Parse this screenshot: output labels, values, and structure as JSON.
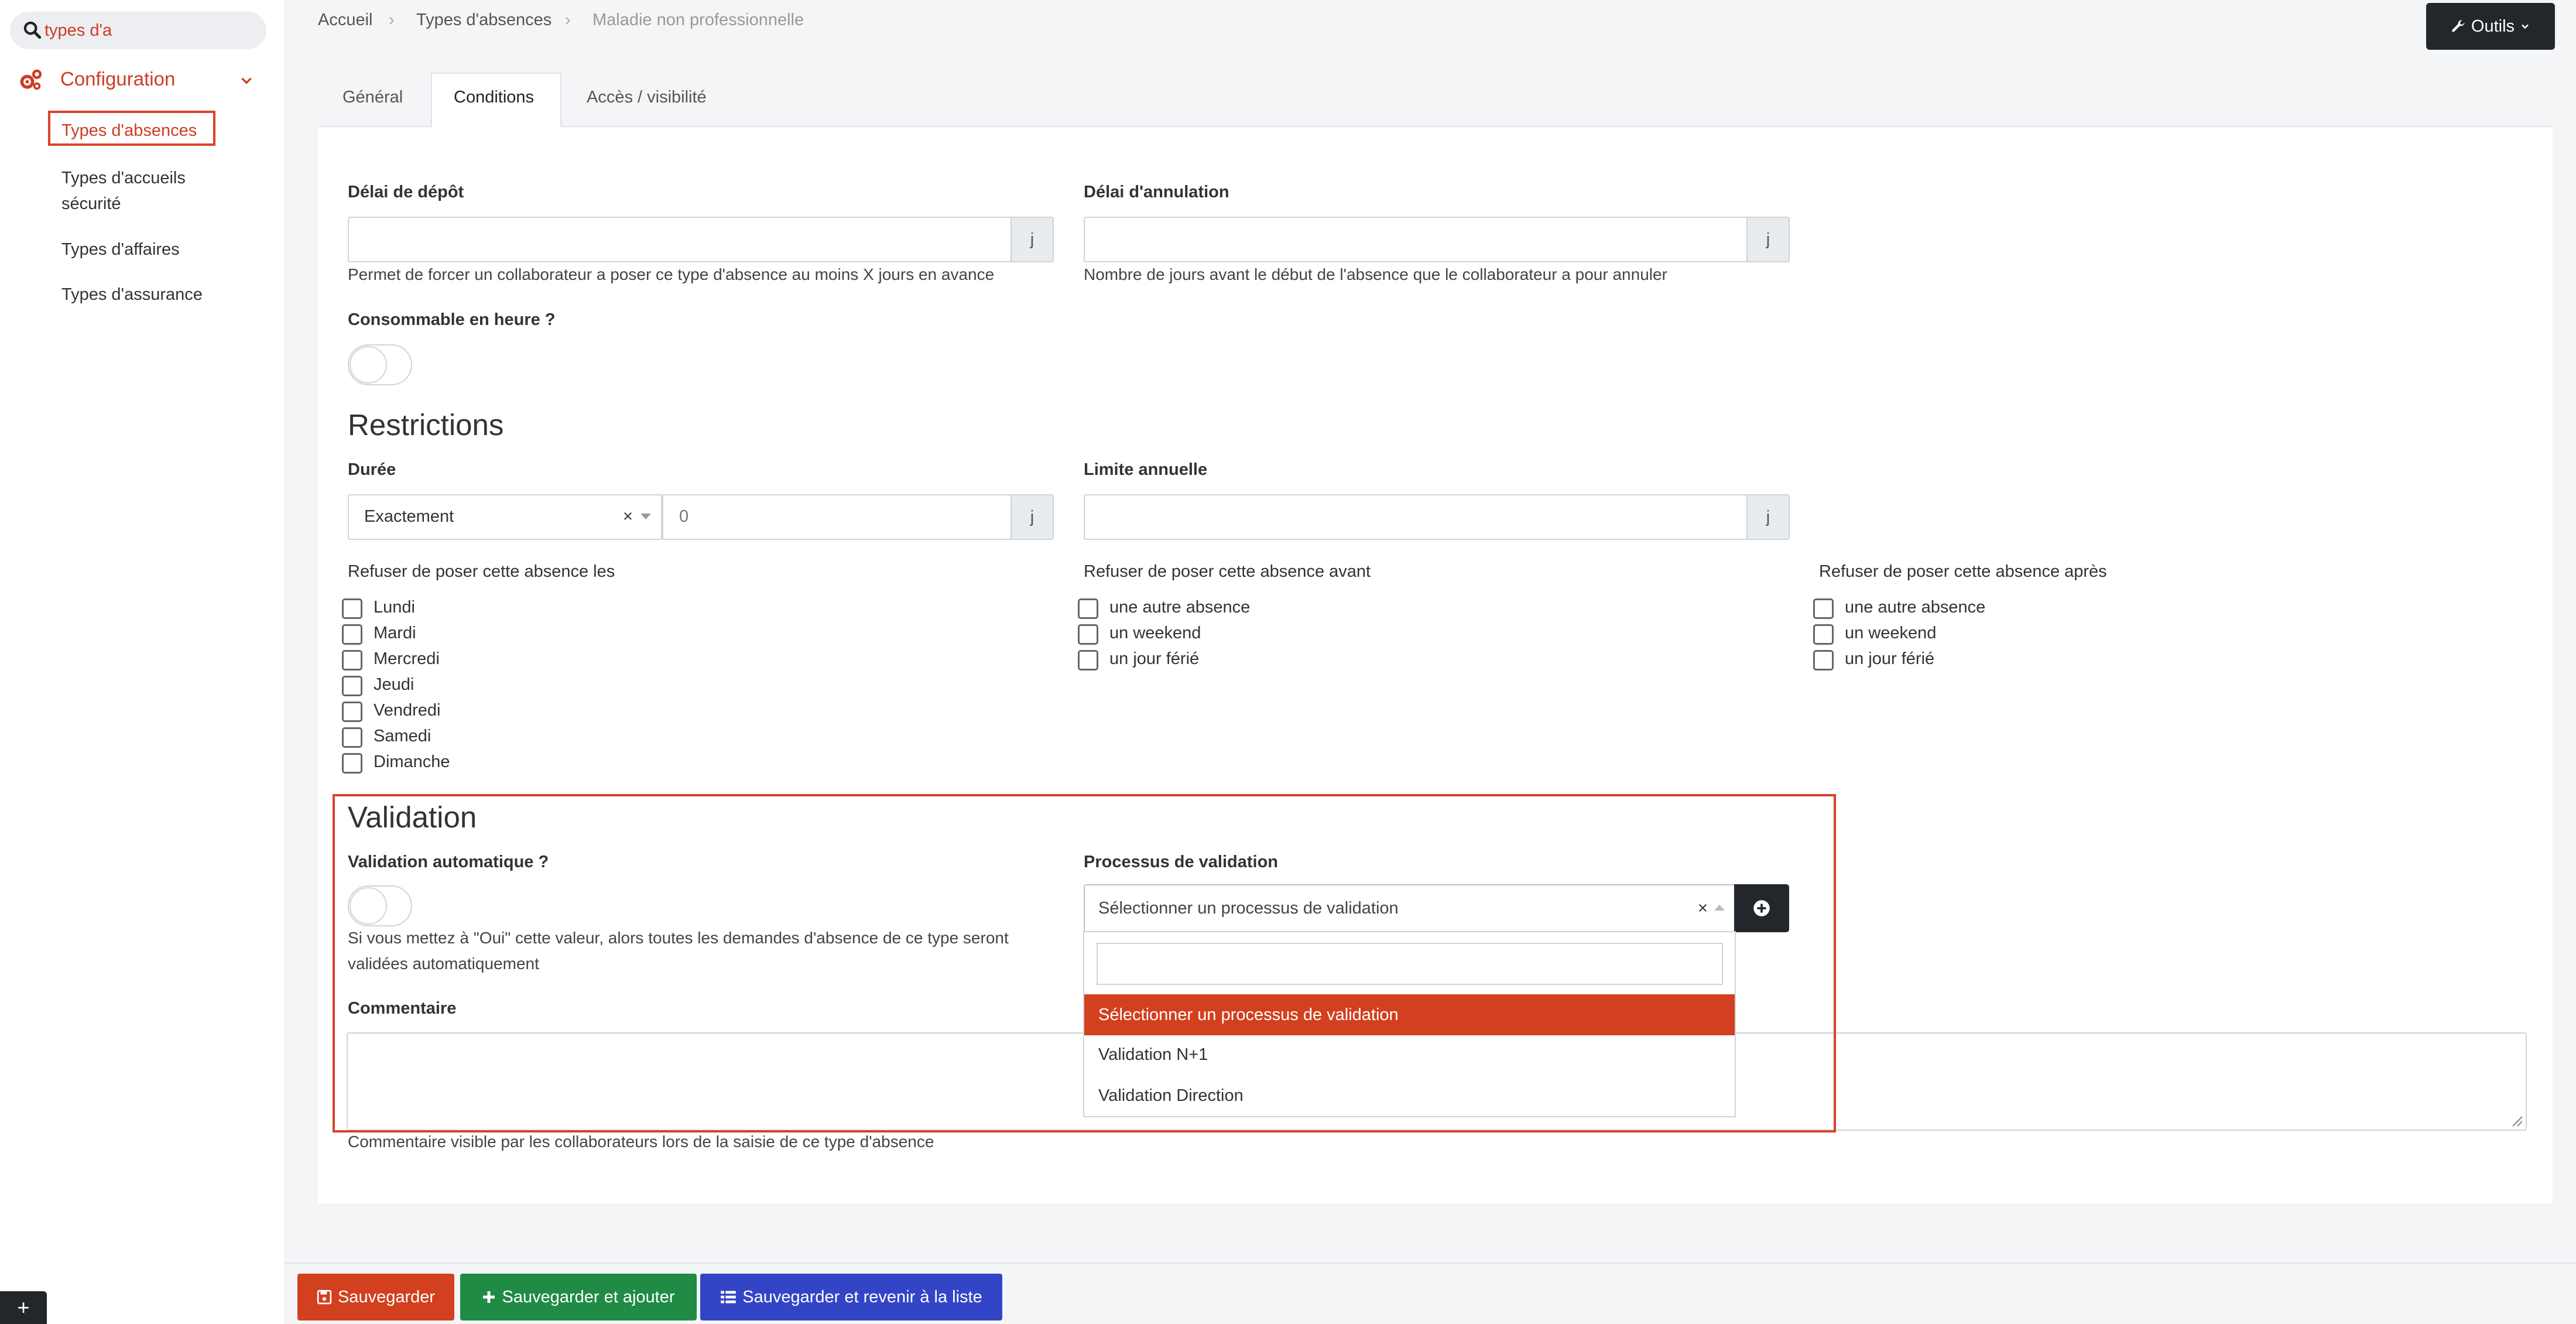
{
  "sidebar": {
    "search_value": "types d'a",
    "section_label": "Configuration",
    "items": [
      {
        "label": "Types d'absences",
        "active": true
      },
      {
        "label": "Types d'accueils sécurité",
        "line1": "Types d'accueils",
        "line2": "sécurité"
      },
      {
        "label": "Types d'affaires"
      },
      {
        "label": "Types d'assurance"
      }
    ]
  },
  "breadcrumb": [
    "Accueil",
    "Types d'absences",
    "Maladie non professionnelle"
  ],
  "tools_label": "Outils",
  "tabs": [
    "Général",
    "Conditions",
    "Accès / visibilité"
  ],
  "form": {
    "delai_depot": {
      "label": "Délai de dépôt",
      "value": "",
      "addon": "j",
      "help": "Permet de forcer un collaborateur a poser ce type d'absence au moins X jours en avance"
    },
    "delai_annulation": {
      "label": "Délai d'annulation",
      "value": "",
      "addon": "j",
      "help": "Nombre de jours avant le début de l'absence que le collaborateur a pour annuler"
    },
    "consommable": {
      "label": "Consommable en heure ?"
    },
    "restrictions_title": "Restrictions",
    "duree": {
      "label": "Durée",
      "select_value": "Exactement",
      "clear": "×",
      "number_value": "0",
      "addon": "j"
    },
    "limite": {
      "label": "Limite annuelle",
      "value": "",
      "addon": "j"
    },
    "refuser_les": {
      "label": "Refuser de poser cette absence les",
      "options": [
        "Lundi",
        "Mardi",
        "Mercredi",
        "Jeudi",
        "Vendredi",
        "Samedi",
        "Dimanche"
      ]
    },
    "refuser_avant": {
      "label": "Refuser de poser cette absence avant",
      "options": [
        "une autre absence",
        "un weekend",
        "un jour férié"
      ]
    },
    "refuser_apres": {
      "label": "Refuser de poser cette absence après",
      "options": [
        "une autre absence",
        "un weekend",
        "un jour férié"
      ]
    },
    "validation_title": "Validation",
    "validation_auto": {
      "label": "Validation automatique ?",
      "help_line1": "Si vous mettez à \"Oui\" cette valeur, alors toutes les demandes d'absence de ce type seront",
      "help_line2": "validées automatiquement"
    },
    "processus": {
      "label": "Processus de validation",
      "placeholder": "Sélectionner un processus de validation",
      "clear": "×",
      "search_value": "",
      "options": [
        "Sélectionner un processus de validation",
        "Validation N+1",
        "Validation Direction"
      ]
    },
    "commentaire": {
      "label": "Commentaire",
      "value": "",
      "help": "Commentaire visible par les collaborateurs lors de la saisie de ce type d'absence"
    }
  },
  "footer": {
    "save": "Sauvegarder",
    "save_add": "Sauvegarder et ajouter",
    "save_back": "Sauvegarder et revenir à la liste",
    "corner": "+"
  },
  "colors": {
    "accent": "#d2401f",
    "dark": "#23272b",
    "green": "#1f8b45",
    "blue": "#3345c7"
  }
}
